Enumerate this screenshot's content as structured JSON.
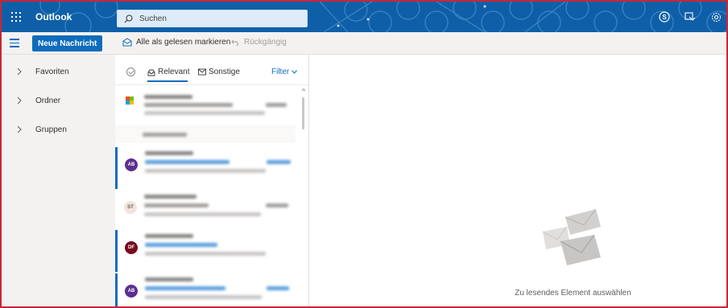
{
  "app": {
    "name": "Outlook"
  },
  "search": {
    "placeholder": "Suchen"
  },
  "command_bar": {
    "new_message_label": "Neue Nachricht",
    "mark_all_read_label": "Alle als gelesen markieren",
    "undo_label": "Rückgängig"
  },
  "nav": {
    "items": [
      {
        "label": "Favoriten"
      },
      {
        "label": "Ordner"
      },
      {
        "label": "Gruppen"
      }
    ]
  },
  "message_list": {
    "tabs": [
      {
        "label": "Relevant",
        "active": true
      },
      {
        "label": "Sonstige",
        "active": false
      }
    ],
    "filter_label": "Filter",
    "messages": [
      {
        "avatar": "",
        "type": "microsoft-logo",
        "unread": false
      },
      {
        "avatar": "AB",
        "color": "#5c2e91",
        "unread": true
      },
      {
        "avatar": "ST",
        "color": "#e8dcd6",
        "unread": false
      },
      {
        "avatar": "DF",
        "color": "#750b1c",
        "unread": true
      },
      {
        "avatar": "AB",
        "color": "#5c2e91",
        "unread": true
      }
    ]
  },
  "reading_pane": {
    "empty_text": "Zu lesendes Element auswählen"
  },
  "icons": {
    "waffle": "app-launcher-icon",
    "search": "search-icon",
    "skype": "skype-icon",
    "my_day": "my-day-icon",
    "settings": "gear-icon"
  },
  "colors": {
    "accent": "#0f6cbd",
    "header": "#0f5fa8",
    "frame": "#c62735"
  }
}
